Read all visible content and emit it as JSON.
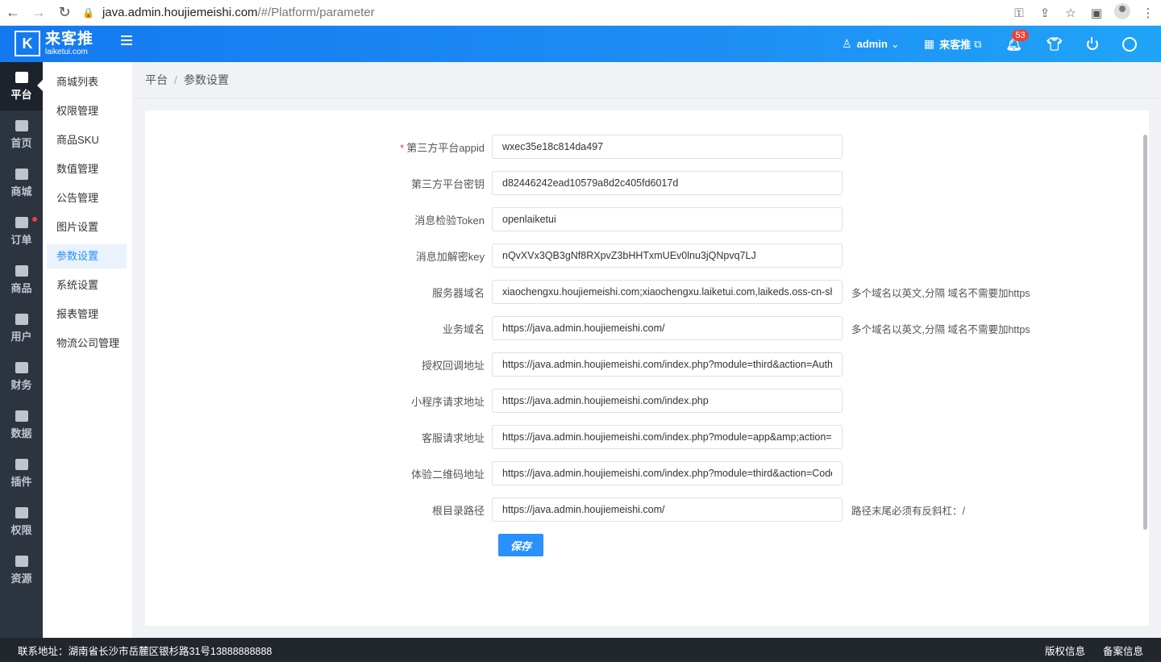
{
  "browser": {
    "url_host": "java.admin.houjiemeishi.com",
    "url_path": "/#/Platform/parameter"
  },
  "header": {
    "logo_title": "来客推",
    "logo_sub": "laiketui.com",
    "logo_mark": "K",
    "user": "admin",
    "store": "来客推",
    "notification_count": "53"
  },
  "rail": [
    {
      "label": "平台",
      "icon": "platform-icon",
      "active": true
    },
    {
      "label": "首页",
      "icon": "home-icon"
    },
    {
      "label": "商城",
      "icon": "mall-icon"
    },
    {
      "label": "订单",
      "icon": "order-icon",
      "dot": true
    },
    {
      "label": "商品",
      "icon": "goods-icon"
    },
    {
      "label": "用户",
      "icon": "user-icon"
    },
    {
      "label": "财务",
      "icon": "finance-icon"
    },
    {
      "label": "数据",
      "icon": "data-icon"
    },
    {
      "label": "插件",
      "icon": "plugin-icon"
    },
    {
      "label": "权限",
      "icon": "permission-icon"
    },
    {
      "label": "资源",
      "icon": "resource-icon"
    }
  ],
  "submenu": [
    "商城列表",
    "权限管理",
    "商品SKU",
    "数值管理",
    "公告管理",
    "图片设置",
    "参数设置",
    "系统设置",
    "报表管理",
    "物流公司管理"
  ],
  "submenu_active": 6,
  "breadcrumb": {
    "root": "平台",
    "sep": "/",
    "current": "参数设置"
  },
  "form": [
    {
      "label": "第三方平台appid",
      "required": true,
      "value": "wxec35e18c814da497",
      "hint": ""
    },
    {
      "label": "第三方平台密钥",
      "value": "d82446242ead10579a8d2c405fd6017d",
      "hint": ""
    },
    {
      "label": "消息检验Token",
      "value": "openlaiketui",
      "hint": ""
    },
    {
      "label": "消息加解密key",
      "value": "nQvXVx3QB3gNf8RXpvZ3bHHTxmUEv0lnu3jQNpvq7LJ",
      "hint": ""
    },
    {
      "label": "服务器域名",
      "value": "xiaochengxu.houjiemeishi.com;xiaochengxu.laiketui.com,laikeds.oss-cn-shen",
      "hint": "多个域名以英文,分隔 域名不需要加https"
    },
    {
      "label": "业务域名",
      "value": "https://java.admin.houjiemeishi.com/",
      "hint": "多个域名以英文,分隔 域名不需要加https"
    },
    {
      "label": "授权回调地址",
      "value": "https://java.admin.houjiemeishi.com/index.php?module=third&action=AuthInfo",
      "hint": ""
    },
    {
      "label": "小程序请求地址",
      "value": "https://java.admin.houjiemeishi.com/index.php",
      "hint": ""
    },
    {
      "label": "客服请求地址",
      "value": "https://java.admin.houjiemeishi.com/index.php?module=app&amp;action=kefu",
      "hint": ""
    },
    {
      "label": "体验二维码地址",
      "value": "https://java.admin.houjiemeishi.com/index.php?module=third&action=Code",
      "hint": ""
    },
    {
      "label": "根目录路径",
      "value": "https://java.admin.houjiemeishi.com/",
      "hint": "路径末尾必须有反斜杠：/"
    }
  ],
  "save_label": "保存",
  "footer": {
    "address": "联系地址：湖南省长沙市岳麓区银杉路31号13888888888",
    "copyright": "版权信息",
    "icp": "备案信息"
  }
}
